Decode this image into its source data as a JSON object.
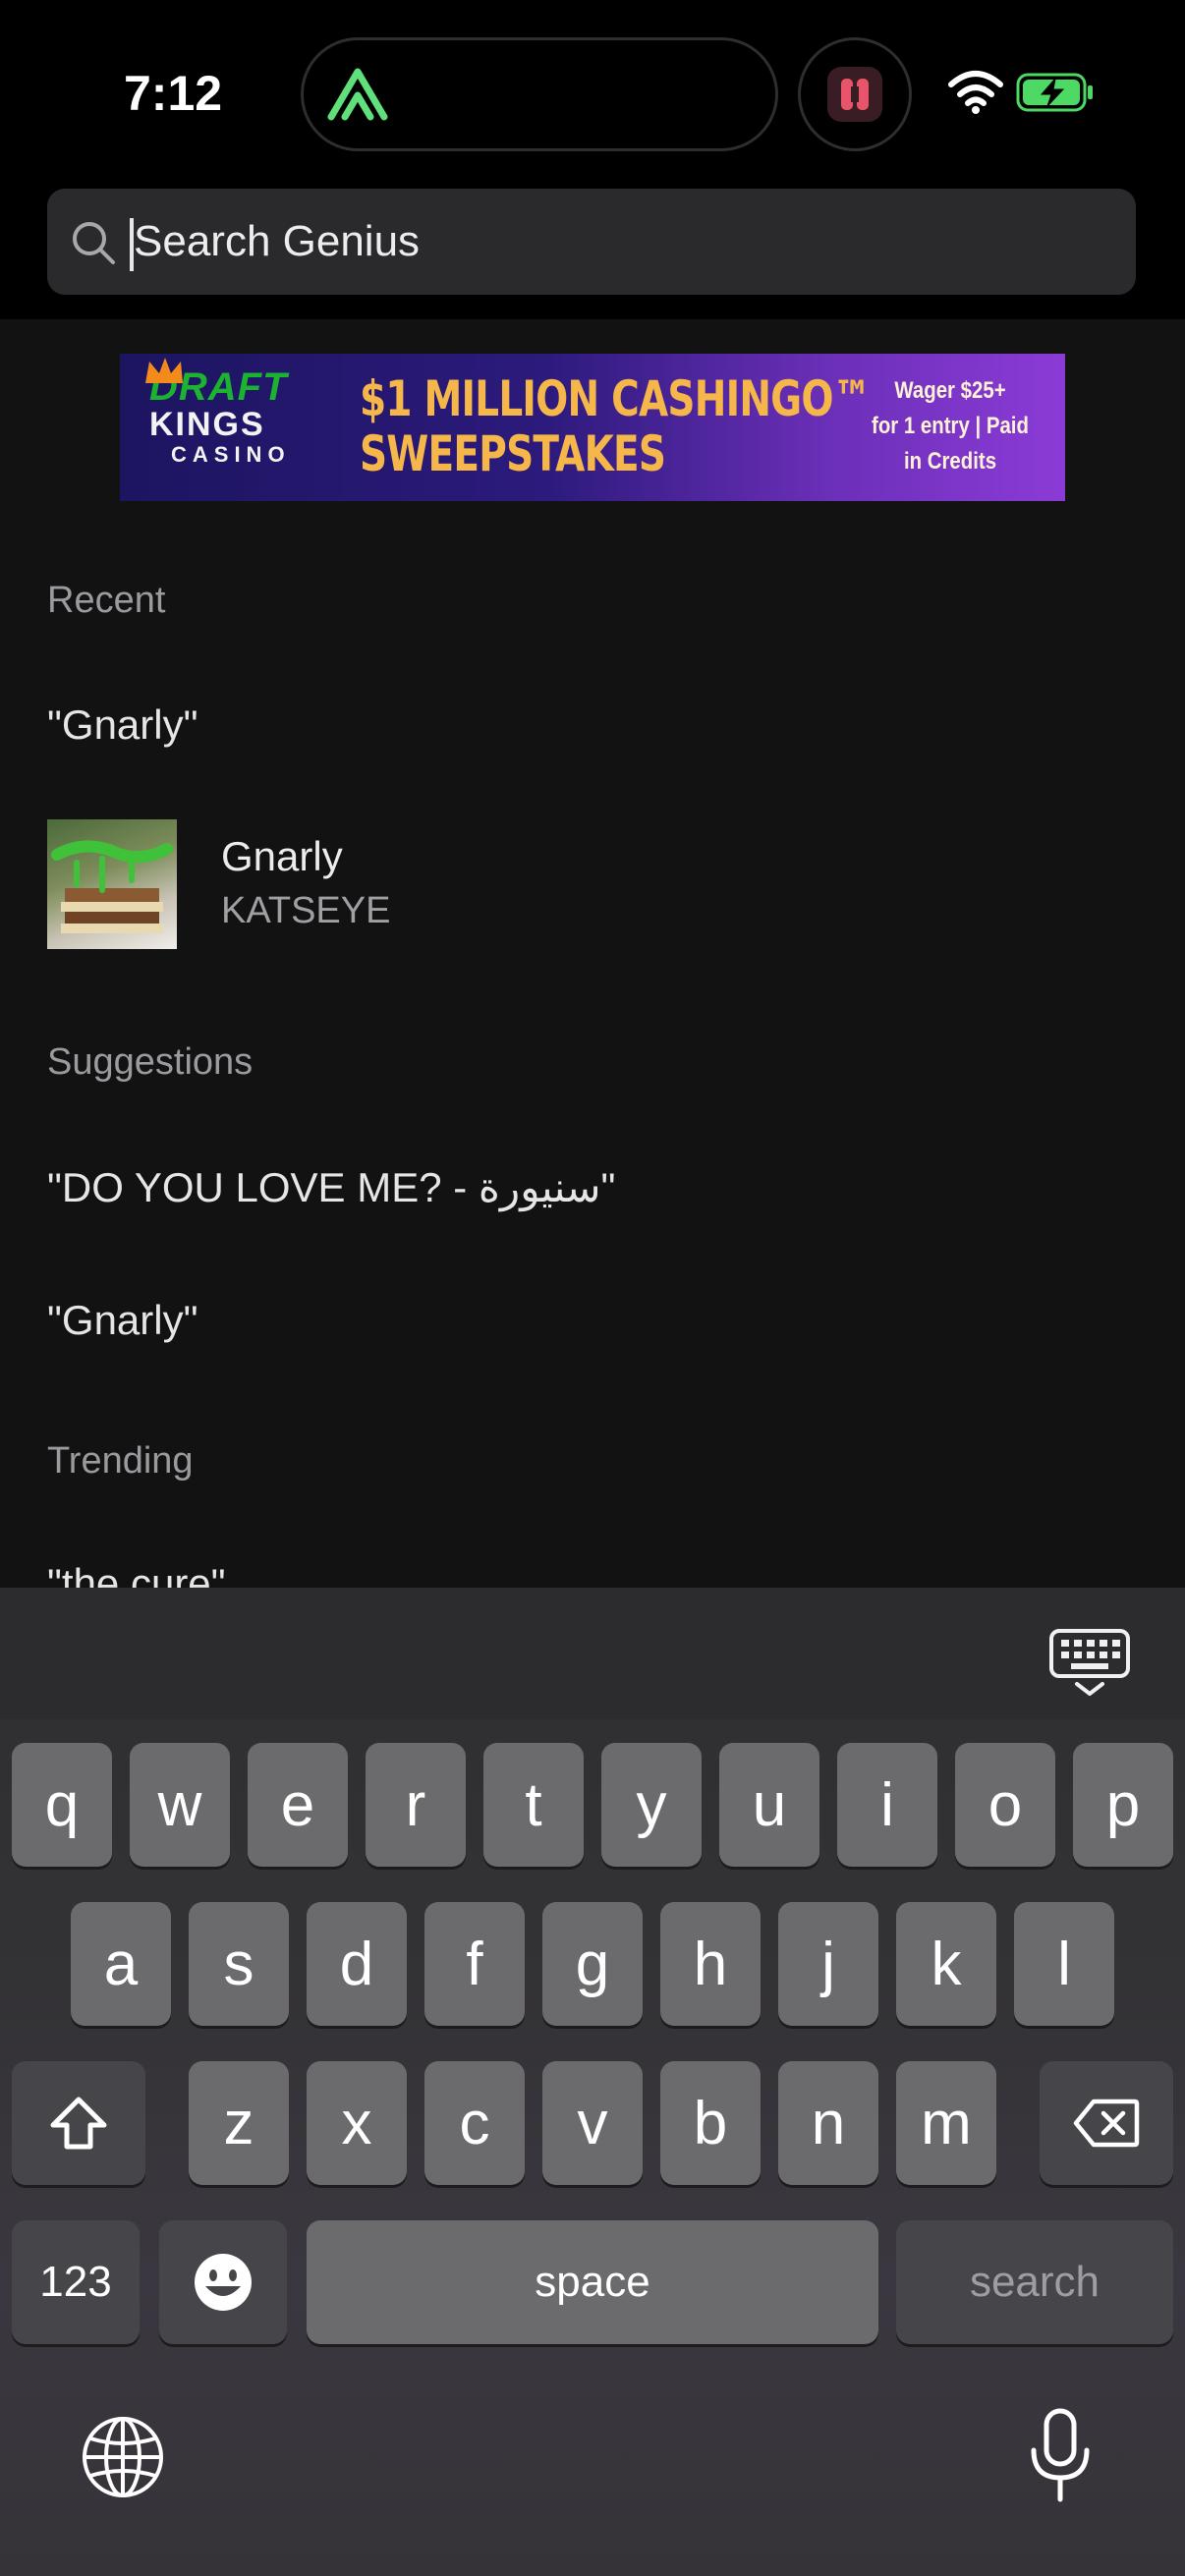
{
  "status_bar": {
    "time": "7:12"
  },
  "search": {
    "placeholder": "Search Genius",
    "value": ""
  },
  "banner": {
    "brand_line1": "DRAFT",
    "brand_line2": "KINGS",
    "brand_line3": "CASINO",
    "promo_line1": "$1 MILLION CASHINGO™",
    "promo_line2": "SWEEPSTAKES",
    "terms_line1": "Wager $25+",
    "terms_line2": "for 1 entry | Paid",
    "terms_line3": "in Credits"
  },
  "recent": {
    "label": "Recent",
    "query": "\"Gnarly\"",
    "song": {
      "title": "Gnarly",
      "artist": "KATSEYE"
    }
  },
  "suggestions": {
    "label": "Suggestions",
    "items": [
      "\"DO YOU LOVE ME? - سنيورة\"",
      "\"Gnarly\""
    ]
  },
  "trending": {
    "label": "Trending",
    "items": [
      "\"the cure\""
    ]
  },
  "keyboard": {
    "row1": [
      "q",
      "w",
      "e",
      "r",
      "t",
      "y",
      "u",
      "i",
      "o",
      "p"
    ],
    "row2": [
      "a",
      "s",
      "d",
      "f",
      "g",
      "h",
      "j",
      "k",
      "l"
    ],
    "row3": [
      "z",
      "x",
      "c",
      "v",
      "b",
      "n",
      "m"
    ],
    "numbers_label": "123",
    "space_label": "space",
    "search_label": "search"
  },
  "colors": {
    "accent_green": "#5fe07a",
    "battery_green": "#4cd964",
    "background": "#121213"
  }
}
